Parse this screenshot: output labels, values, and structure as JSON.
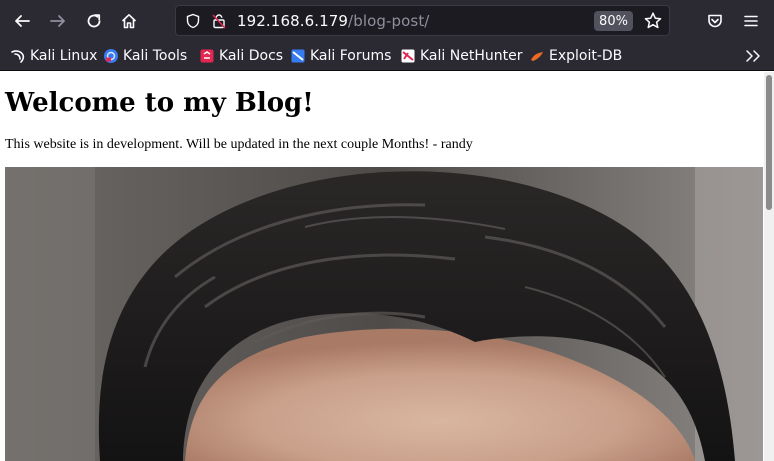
{
  "browser": {
    "url_host": "192.168.6.179",
    "url_path": "/blog-post/",
    "zoom": "80%"
  },
  "bookmarks": [
    {
      "label": "Kali Linux",
      "icon": "kali-dragon-icon"
    },
    {
      "label": "Kali Tools",
      "icon": "kali-tools-icon"
    },
    {
      "label": "Kali Docs",
      "icon": "kali-docs-icon"
    },
    {
      "label": "Kali Forums",
      "icon": "kali-forums-icon"
    },
    {
      "label": "Kali NetHunter",
      "icon": "kali-nethunter-icon"
    },
    {
      "label": "Exploit-DB",
      "icon": "exploit-db-icon"
    }
  ],
  "page": {
    "title": "Welcome to my Blog!",
    "text": "This website is in development. Will be updated in the next couple Months! - randy"
  },
  "colors": {
    "chrome": "#2b2a33",
    "urlbar": "#1c1b22",
    "text_light": "#fbfbfe"
  }
}
